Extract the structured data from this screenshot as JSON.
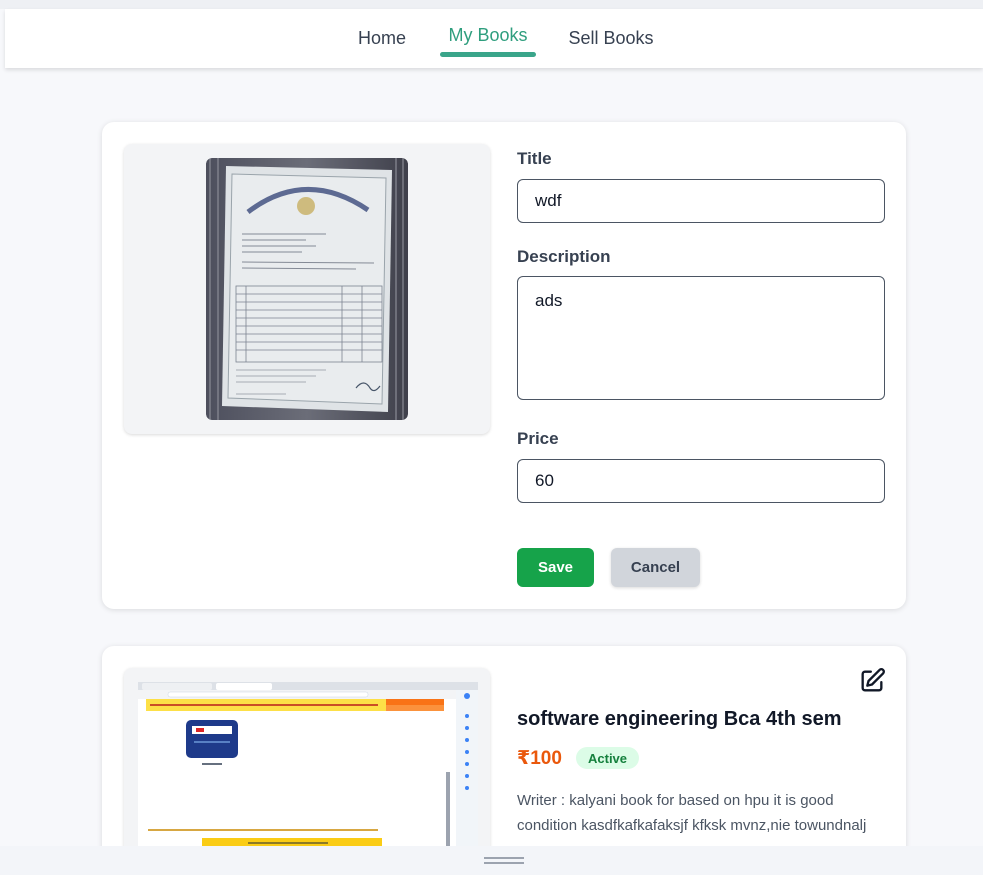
{
  "nav": {
    "items": [
      {
        "label": "Home"
      },
      {
        "label": "My Books"
      },
      {
        "label": "Sell Books"
      }
    ],
    "active_index": 1
  },
  "edit_form": {
    "title_label": "Title",
    "title_value": "wdf",
    "description_label": "Description",
    "description_value": "ads",
    "price_label": "Price",
    "price_value": "60",
    "save_label": "Save",
    "cancel_label": "Cancel"
  },
  "book": {
    "title": "software engineering Bca 4th sem",
    "price": "₹100",
    "status": "Active",
    "description": "Writer : kalyani book for based on hpu it is good condition kasdfkafkafaksjf kfksk mvnz,nie towundnalj"
  },
  "colors": {
    "accent": "#3aa58a",
    "save": "#16a34a",
    "price": "#ea580c",
    "badge_bg": "#dcfce7"
  }
}
